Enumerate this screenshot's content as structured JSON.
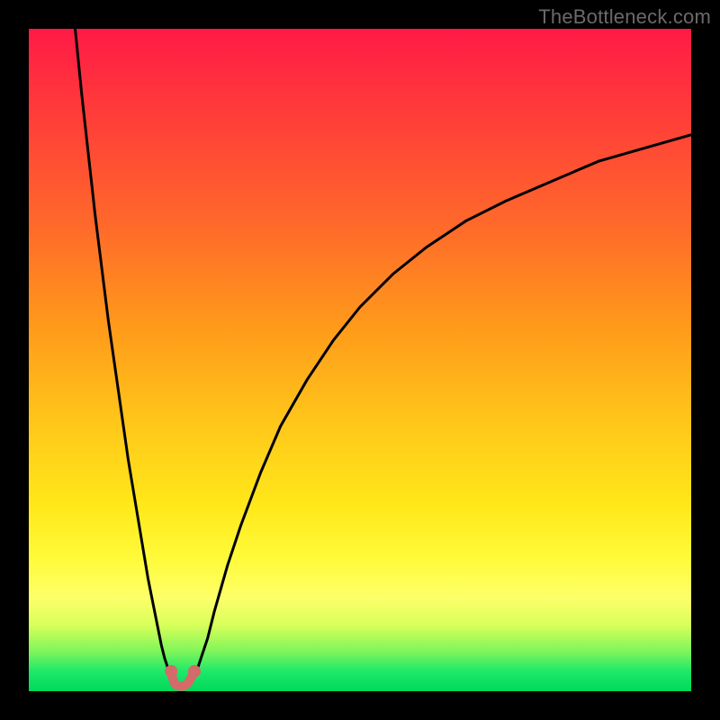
{
  "watermark": "TheBottleneck.com",
  "colors": {
    "background": "#000000",
    "curve_stroke": "#000000",
    "notch_stroke": "#d46a6a",
    "gradient_top": "#ff1a46",
    "gradient_bottom": "#00d95a"
  },
  "chart_data": {
    "type": "line",
    "title": "",
    "xlabel": "",
    "ylabel": "",
    "xlim": [
      0,
      100
    ],
    "ylim": [
      0,
      100
    ],
    "grid": false,
    "legend": false,
    "series": [
      {
        "name": "left-branch",
        "x": [
          7,
          8,
          9,
          10,
          11,
          12,
          13,
          14,
          15,
          16,
          17,
          18,
          19,
          20,
          20.5,
          21,
          21.5
        ],
        "y": [
          100,
          90,
          81,
          72,
          64,
          56,
          49,
          42,
          35,
          29,
          23,
          17,
          12,
          7,
          5,
          3.5,
          3
        ]
      },
      {
        "name": "right-branch",
        "x": [
          25,
          25.5,
          26,
          27,
          28,
          30,
          32,
          35,
          38,
          42,
          46,
          50,
          55,
          60,
          66,
          72,
          79,
          86,
          93,
          100
        ],
        "y": [
          3,
          3.5,
          5,
          8,
          12,
          19,
          25,
          33,
          40,
          47,
          53,
          58,
          63,
          67,
          71,
          74,
          77,
          80,
          82,
          84
        ]
      },
      {
        "name": "bottom-notch",
        "x": [
          21.5,
          21.7,
          22.0,
          22.5,
          23.0,
          23.5,
          24.0,
          24.5,
          25.0
        ],
        "y": [
          3,
          2,
          1.2,
          0.8,
          0.7,
          0.8,
          1.2,
          2,
          3
        ]
      }
    ],
    "notch_endpoints": {
      "left": {
        "x": 21.5,
        "y": 3
      },
      "right": {
        "x": 25.0,
        "y": 3
      }
    }
  }
}
